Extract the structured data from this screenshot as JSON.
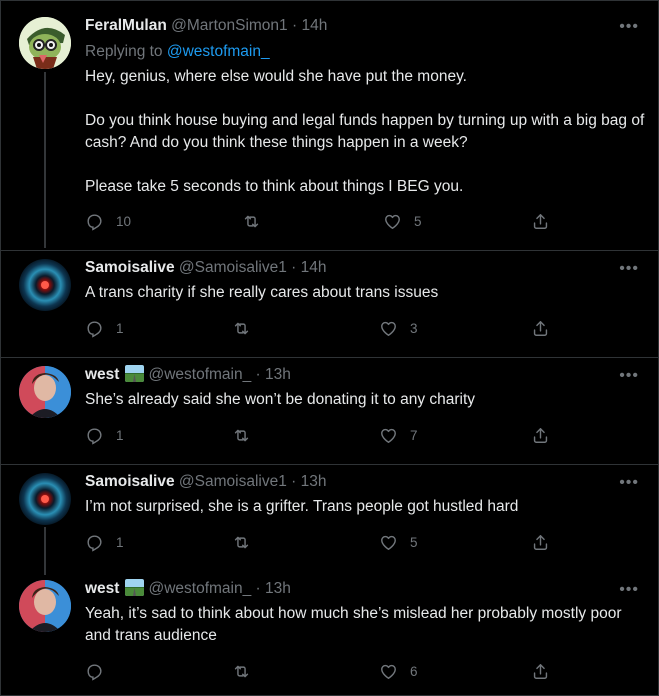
{
  "tweets": [
    {
      "name": "FeralMulan",
      "handle": "@MartonSimon1",
      "time": "· 14h",
      "replying_prefix": "Replying to",
      "replying_handle": "@westofmain_",
      "paragraphs": [
        "Hey, genius, where else would she have put the money.",
        "Do you think house buying and legal funds happen by turning up with a big bag of cash? And do you think these things happen in a week?",
        "Please take 5 seconds to think about things I BEG you."
      ],
      "replies": "10",
      "retweets": "",
      "likes": "5"
    },
    {
      "name": "Samoisalive",
      "handle": "@Samoisalive1",
      "time": "· 14h",
      "paragraphs": [
        "A trans charity if she really cares about trans issues"
      ],
      "replies": "1",
      "retweets": "",
      "likes": "3"
    },
    {
      "name": "west",
      "handle": "@westofmain_",
      "time": "· 13h",
      "paragraphs": [
        "She’s already said she won’t be donating it to any charity"
      ],
      "replies": "1",
      "retweets": "",
      "likes": "7"
    },
    {
      "name": "Samoisalive",
      "handle": "@Samoisalive1",
      "time": "· 13h",
      "paragraphs": [
        "I’m not surprised, she is a grifter. Trans people got hustled hard"
      ],
      "replies": "1",
      "retweets": "",
      "likes": "5"
    },
    {
      "name": "west",
      "handle": "@westofmain_",
      "time": "· 13h",
      "paragraphs": [
        "Yeah, it’s sad to think about how much she’s mislead her probably mostly poor and trans audience"
      ],
      "replies": "",
      "retweets": "",
      "likes": "6"
    }
  ],
  "more_glyph": "•••",
  "colors": {
    "background": "#000000",
    "text": "#e7e9ea",
    "muted": "#71767b",
    "link": "#1d9bf0",
    "divider": "#2f3336"
  },
  "icons": [
    "reply-icon",
    "retweet-icon",
    "like-icon",
    "share-icon",
    "more-icon",
    "flag-emoji-icon"
  ]
}
